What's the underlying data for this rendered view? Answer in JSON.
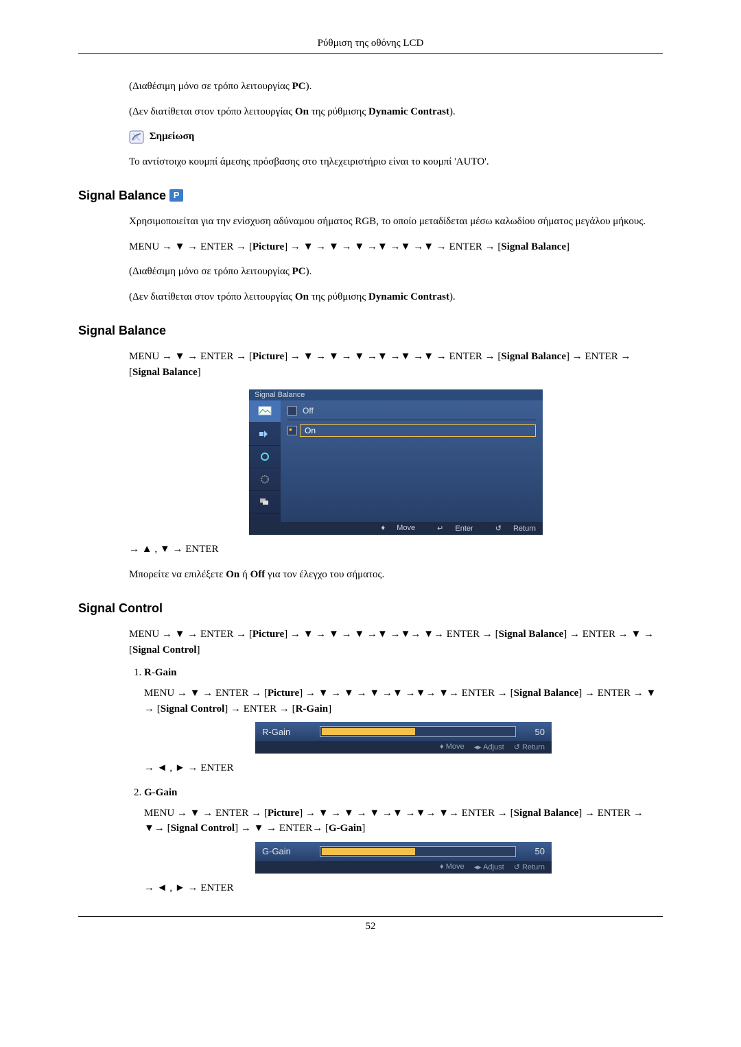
{
  "header": "Ρύθμιση της οθόνης LCD",
  "page_number": "52",
  "intro": {
    "avail_pc": "(Διαθέσιμη μόνο σε τρόπο λειτουργίας ",
    "pc": "PC",
    "avail_pc_end": ").",
    "not_on": "(Δεν διατίθεται στον τρόπο λειτουργίας ",
    "on": "On",
    "not_on_mid": " της ρύθμισης ",
    "dc": "Dynamic Contrast",
    "not_on_end": ").",
    "note_label": "Σημείωση",
    "note_text": "Το αντίστοιχο κουμπί άμεσης πρόσβασης στο τηλεχειριστήριο είναι το κουμπί 'AUTO'."
  },
  "sb1": {
    "heading": "Signal Balance",
    "desc": "Χρησιμοποιείται για την ενίσχυση αδύναμου σήματος RGB, το οποίο μεταδίδεται μέσω καλωδίου σήματος μεγάλου μήκους.",
    "path_pre": "MENU → ▼ → ENTER → [",
    "picture": "Picture",
    "path_mid": "] → ▼ → ▼ → ▼ →▼ →▼ →▼ → ENTER → [",
    "sb": "Signal Balance",
    "path_end": "]"
  },
  "sb2": {
    "heading": "Signal Balance",
    "path1": "MENU → ▼ → ENTER → [",
    "picture": "Picture",
    "path2": "] → ▼ → ▼ → ▼ →▼ →▼ →▼ → ENTER → [",
    "sb": "Signal Balance",
    "path3": "] → ENTER → [",
    "sb2": "Signal Balance",
    "path4": "]",
    "osd_title": "Signal Balance",
    "opt_off": "Off",
    "opt_on": "On",
    "foot_move": "Move",
    "foot_enter": "Enter",
    "foot_return": "Return",
    "post": "→ ▲ , ▼ → ENTER",
    "note_text_pre": "Μπορείτε να επιλέξετε ",
    "note_on": "On",
    "note_mid": " ή ",
    "note_off": "Off",
    "note_end": " για τον έλεγχο του σήματος."
  },
  "sc": {
    "heading": "Signal Control",
    "path1": "MENU → ▼ → ENTER → [",
    "picture": "Picture",
    "path2": "] → ▼ → ▼ → ▼ →▼ →▼→ ▼→ ENTER → [",
    "sb": "Signal Balance",
    "path3": "] → ENTER → ▼ → [",
    "sc": "Signal Control",
    "path4": "]",
    "items": [
      {
        "title": "R-Gain",
        "p_a": "MENU → ▼ → ENTER → [",
        "picture": "Picture",
        "p_b": "] → ▼ → ▼ → ▼ →▼ →▼→ ▼→ ENTER → [",
        "sb1": "Signal Balance",
        "p_c": "] → ENTER → ▼ → [",
        "sc": "Signal Control",
        "p_d": "] → ENTER → [",
        "target": "R-Gain",
        "p_e": "]",
        "slider_label": "R-Gain",
        "slider_value": "50",
        "foot_move": "Move",
        "foot_adjust": "Adjust",
        "foot_return": "Return",
        "post": "→ ◄ , ► → ENTER"
      },
      {
        "title": "G-Gain",
        "p_a": "MENU → ▼ → ENTER → [",
        "picture": "Picture",
        "p_b": "] → ▼ → ▼ → ▼ →▼ →▼→ ▼→ ENTER → [",
        "sb1": "Signal Balance",
        "p_c": "] → ENTER → ▼→ [",
        "sc": "Signal Control",
        "p_d": "] → ▼ → ENTER→ [",
        "target": "G-Gain",
        "p_e": "]",
        "slider_label": "G-Gain",
        "slider_value": "50",
        "foot_move": "Move",
        "foot_adjust": "Adjust",
        "foot_return": "Return",
        "post": "→ ◄ , ► → ENTER"
      }
    ]
  }
}
